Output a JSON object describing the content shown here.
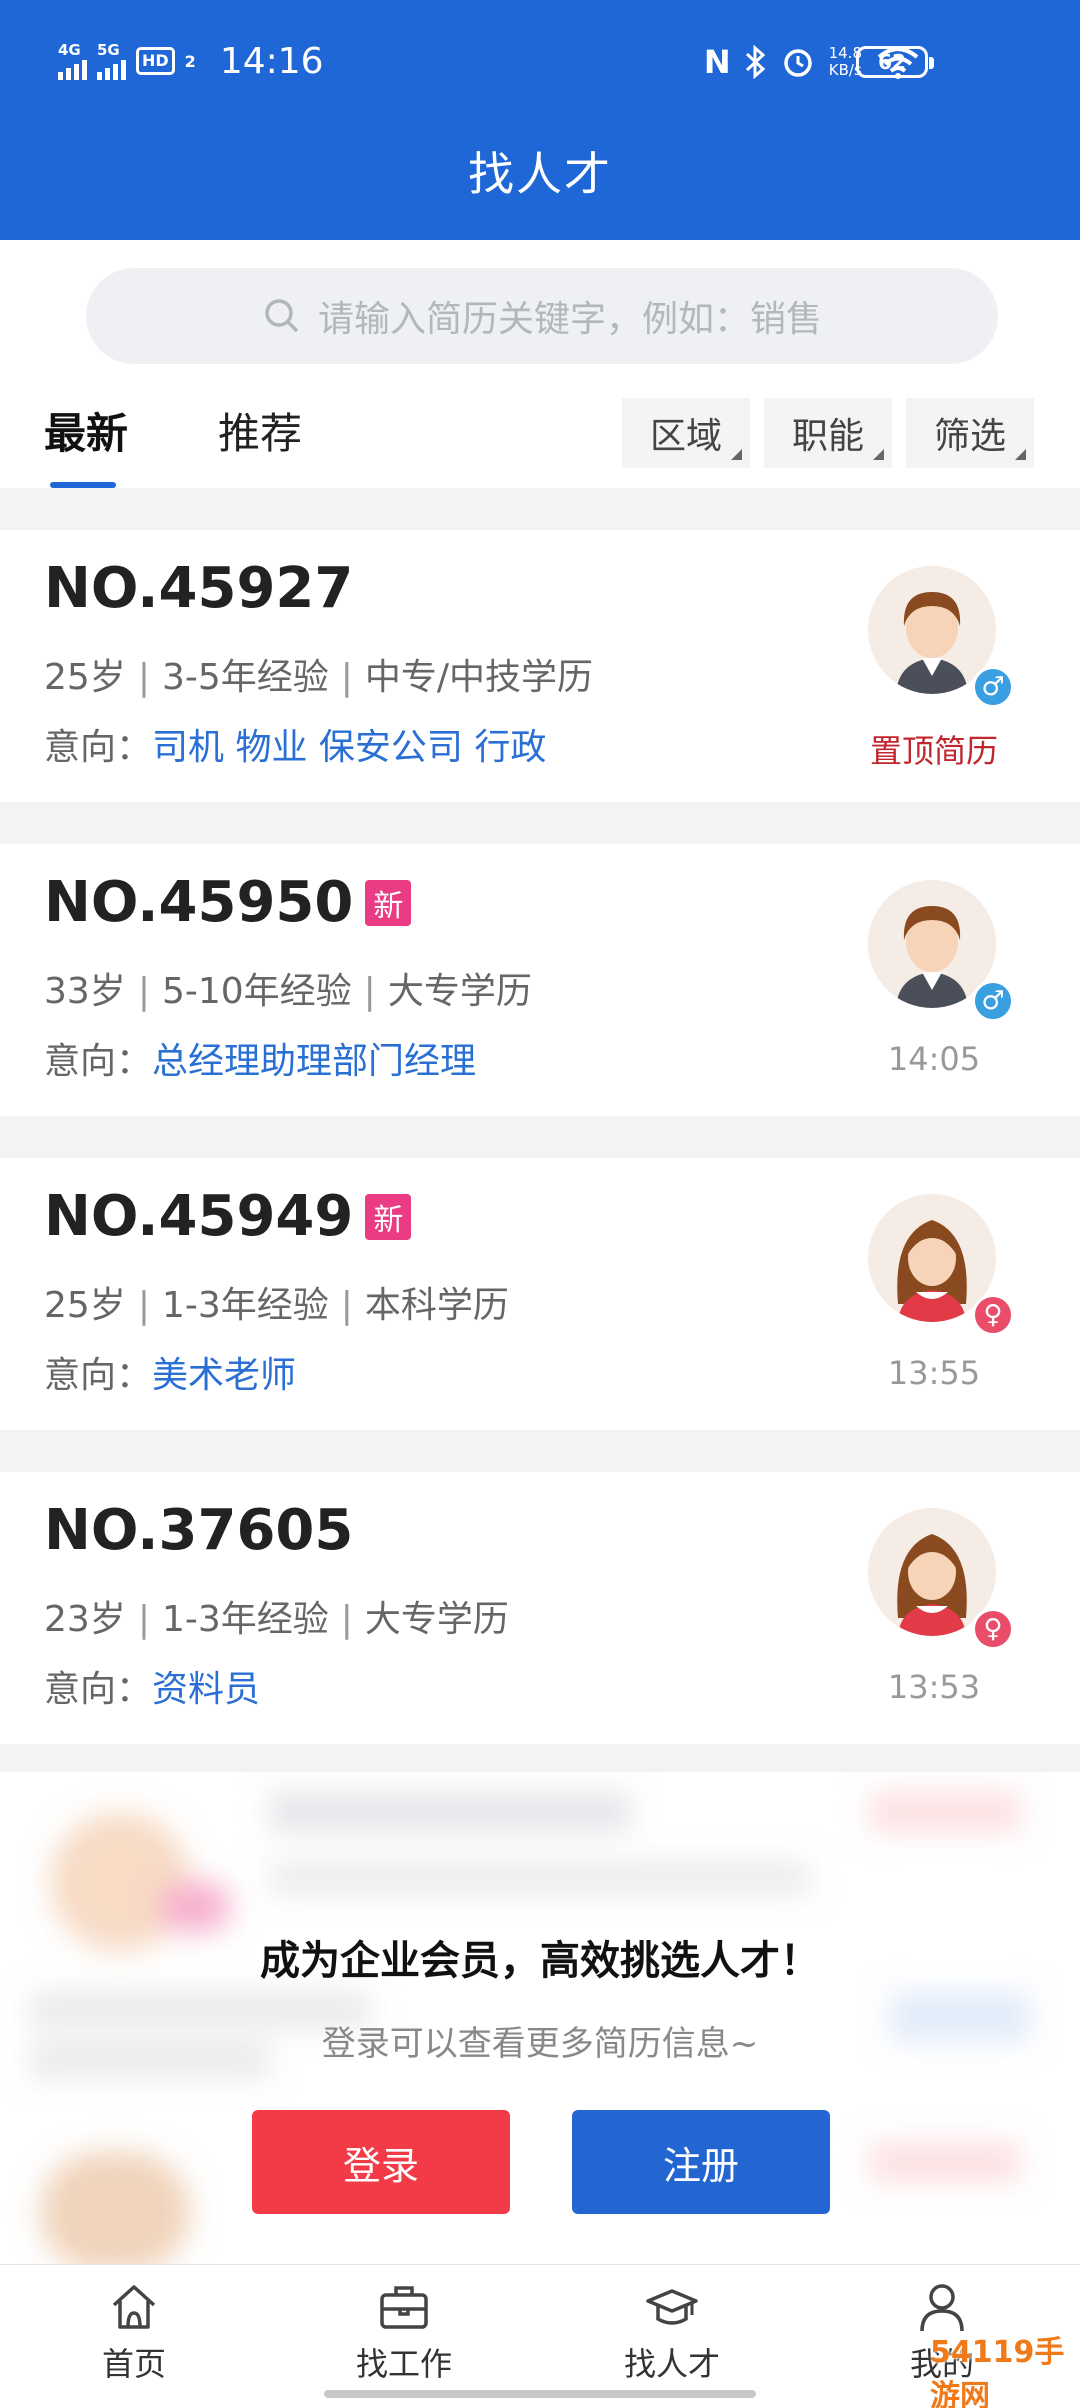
{
  "status_bar": {
    "sig1_label": "4G",
    "sig2_label": "5G",
    "hd_label": "HD",
    "hd_sub": "2",
    "time": "14:16",
    "nfc_label": "N",
    "net_speed_value": "14.8",
    "net_speed_unit": "KB/s",
    "battery": "62"
  },
  "header": {
    "title": "找人才"
  },
  "search": {
    "placeholder": "请输入简历关键字，例如：销售"
  },
  "tabs": {
    "latest": "最新",
    "recommend": "推荐"
  },
  "filters": {
    "region": "区域",
    "function": "职能",
    "screen": "筛选"
  },
  "cards": [
    {
      "no": "NO.45927",
      "is_new": false,
      "age": "25岁",
      "exp": "3-5年经验",
      "edu": "中专/中技学历",
      "intent_label": "意向：",
      "intent": "司机 物业 保安公司 行政",
      "gender": "male",
      "tag": "置顶简历"
    },
    {
      "no": "NO.45950",
      "is_new": true,
      "new_label": "新",
      "age": "33岁",
      "exp": "5-10年经验",
      "edu": "大专学历",
      "intent_label": "意向：",
      "intent": "总经理助理部门经理",
      "gender": "male",
      "time": "14:05"
    },
    {
      "no": "NO.45949",
      "is_new": true,
      "new_label": "新",
      "age": "25岁",
      "exp": "1-3年经验",
      "edu": "本科学历",
      "intent_label": "意向：",
      "intent": "美术老师",
      "gender": "female",
      "time": "13:55"
    },
    {
      "no": "NO.37605",
      "is_new": false,
      "age": "23岁",
      "exp": "1-3年经验",
      "edu": "大专学历",
      "intent_label": "意向：",
      "intent": "资料员",
      "gender": "female",
      "time": "13:53"
    }
  ],
  "cta": {
    "title": "成为企业会员，高效挑选人才！",
    "subtitle": "登录可以查看更多简历信息~",
    "login": "登录",
    "register": "注册"
  },
  "bottom_nav": [
    {
      "label": "首页",
      "icon": "home-icon"
    },
    {
      "label": "找工作",
      "icon": "briefcase-icon"
    },
    {
      "label": "找人才",
      "icon": "graduation-cap-icon"
    },
    {
      "label": "我的",
      "icon": "person-icon"
    }
  ],
  "watermark": "54119手游网",
  "colors": {
    "primary": "#1f66d6",
    "link": "#2a6fd4",
    "danger": "#f23b46",
    "new_badge": "#ea3c84",
    "top_tag": "#c0262d"
  }
}
